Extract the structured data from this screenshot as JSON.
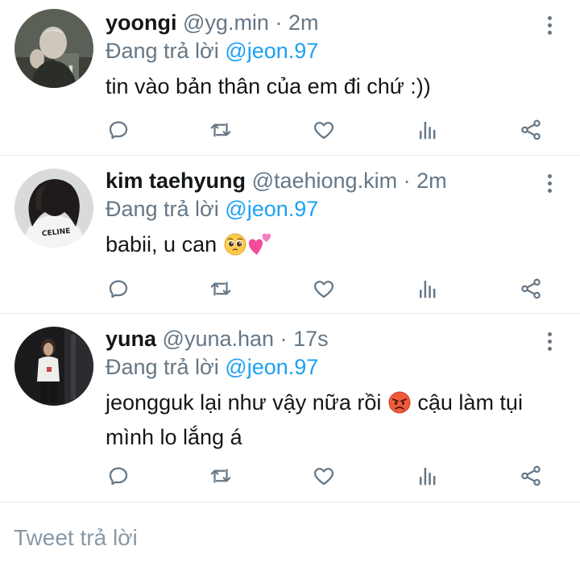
{
  "tweets": [
    {
      "name": "yoongi",
      "handle": "@yg.min",
      "sep": "·",
      "time": "2m",
      "reply_prefix": "Đang trả lời",
      "reply_to": "@jeon.97",
      "text": "tin vào bản thân của em đi chứ :))"
    },
    {
      "name": "kim taehyung",
      "handle": "@taehiong.kim",
      "sep": "·",
      "time": "2m",
      "reply_prefix": "Đang trả lời",
      "reply_to": "@jeon.97",
      "text": "babii, u can",
      "emojis": [
        "pleading-face",
        "two-hearts"
      ]
    },
    {
      "name": "yuna",
      "handle": "@yuna.han",
      "sep": "·",
      "time": "17s",
      "reply_prefix": "Đang trả lời",
      "reply_to": "@jeon.97",
      "text_part1": "jeongguk lại như vậy nữa rồi",
      "text_part2": "cậu làm tụi mình lo lắng á",
      "emojis": [
        "angry-face"
      ],
      "avatar_text": "CELINE"
    }
  ],
  "avatar_shirt_text": "CELINE",
  "actions": [
    "reply-icon",
    "retweet-icon",
    "like-icon",
    "analytics-icon",
    "share-icon"
  ],
  "reply_box": {
    "placeholder": "Tweet trả lời"
  },
  "colors": {
    "text": "#14171a",
    "secondary": "#657786",
    "mention": "#1da1f2",
    "divider": "#e6ecf0",
    "placeholder": "#8899a6"
  }
}
